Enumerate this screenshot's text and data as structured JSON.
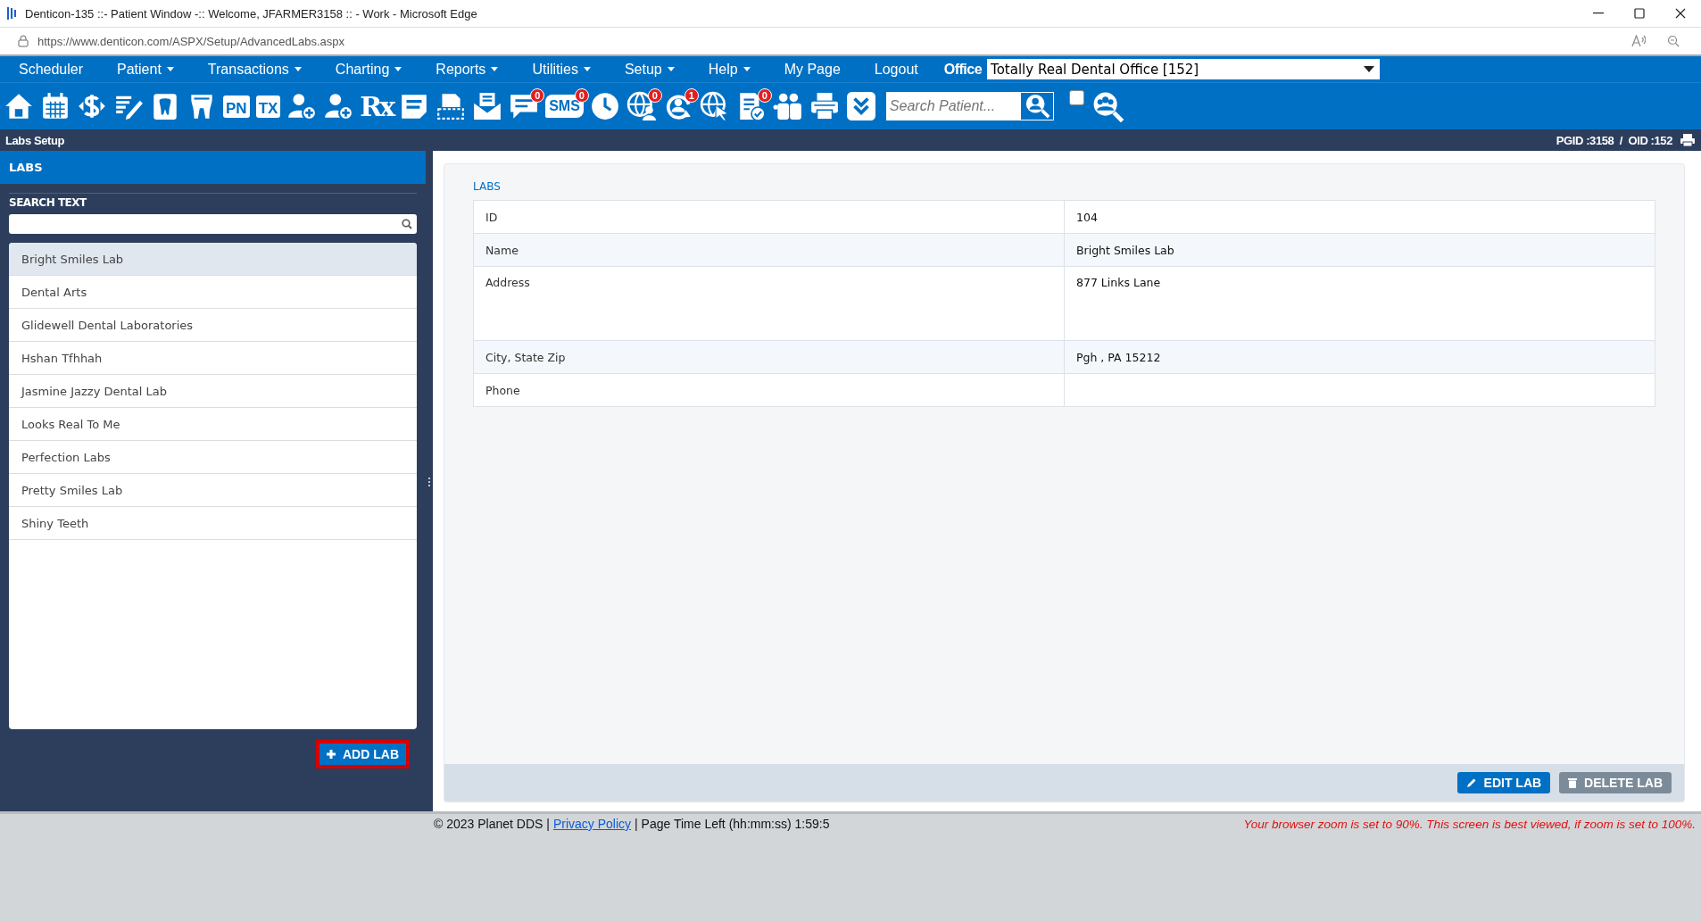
{
  "browser": {
    "title": "Denticon-135 ::- Patient Window -:: Welcome, JFARMER3158 :: - Work - Microsoft Edge",
    "url": "https://www.denticon.com/ASPX/Setup/AdvancedLabs.aspx"
  },
  "menu": {
    "items": [
      {
        "label": "Scheduler",
        "dropdown": false
      },
      {
        "label": "Patient",
        "dropdown": true
      },
      {
        "label": "Transactions",
        "dropdown": true
      },
      {
        "label": "Charting",
        "dropdown": true
      },
      {
        "label": "Reports",
        "dropdown": true
      },
      {
        "label": "Utilities",
        "dropdown": true
      },
      {
        "label": "Setup",
        "dropdown": true
      },
      {
        "label": "Help",
        "dropdown": true
      },
      {
        "label": "My Page",
        "dropdown": false
      },
      {
        "label": "Logout",
        "dropdown": false
      }
    ],
    "office_label": "Office",
    "office_value": "Totally Real Dental Office [152]"
  },
  "toolbar": {
    "items": [
      {
        "kind": "home"
      },
      {
        "kind": "calendar"
      },
      {
        "kind": "dollar"
      },
      {
        "kind": "edit-list"
      },
      {
        "kind": "tooth-chart"
      },
      {
        "kind": "tooth"
      },
      {
        "kind": "tag",
        "label": "PN"
      },
      {
        "kind": "tag",
        "label": "TX"
      },
      {
        "kind": "person-add"
      },
      {
        "kind": "person-add"
      },
      {
        "kind": "letters",
        "label": "Rx"
      },
      {
        "kind": "note"
      },
      {
        "kind": "scanner"
      },
      {
        "kind": "mail"
      },
      {
        "kind": "chat",
        "badge": "0"
      },
      {
        "kind": "bubble",
        "label": "SMS",
        "badge": "0"
      },
      {
        "kind": "clock"
      },
      {
        "kind": "globe-person",
        "badge": "0"
      },
      {
        "kind": "refresh",
        "badge": "1"
      },
      {
        "kind": "globe-cursor"
      },
      {
        "kind": "document",
        "badge": "0"
      },
      {
        "kind": "people"
      },
      {
        "kind": "printer"
      },
      {
        "kind": "chevrons"
      }
    ],
    "search": {
      "placeholder": "Search Patient..."
    },
    "checkbox": {
      "checked": false
    }
  },
  "page_bar": {
    "title": "Labs Setup",
    "ids": "PGID :3158  /  OID :152"
  },
  "sidebar": {
    "title": "LABS",
    "search_label": "SEARCH TEXT",
    "items": [
      {
        "label": "Bright Smiles Lab",
        "selected": true
      },
      {
        "label": "Dental Arts",
        "selected": false
      },
      {
        "label": "Glidewell Dental Laboratories",
        "selected": false
      },
      {
        "label": "Hshan Tfhhah",
        "selected": false
      },
      {
        "label": "Jasmine Jazzy Dental Lab",
        "selected": false
      },
      {
        "label": "Looks Real To Me",
        "selected": false
      },
      {
        "label": "Perfection Labs",
        "selected": false
      },
      {
        "label": "Pretty Smiles Lab",
        "selected": false
      },
      {
        "label": "Shiny Teeth",
        "selected": false
      }
    ],
    "add_button": "ADD LAB"
  },
  "detail": {
    "title": "LABS",
    "rows": [
      {
        "label": "ID",
        "value": "104",
        "kind": "single"
      },
      {
        "label": "Name",
        "value": "Bright Smiles Lab",
        "kind": "single"
      },
      {
        "label": "Address",
        "value": "877 Links Lane",
        "kind": "multiline"
      },
      {
        "label": "City, State Zip",
        "value": "Pgh , PA 15212",
        "kind": "single"
      },
      {
        "label": "Phone",
        "kind": "single"
      }
    ],
    "buttons": [
      {
        "label": "EDIT LAB",
        "kind": "edit"
      },
      {
        "label": "DELETE LAB",
        "kind": "delete"
      }
    ]
  },
  "footer": {
    "copyright": "© 2023 Planet DDS |",
    "link": "Privacy Policy",
    "timer": "| Page Time Left (hh:mm:ss) 1:59:5",
    "warning": "Your browser zoom is set to 90%. This screen is best viewed, if zoom is set to 100%."
  }
}
